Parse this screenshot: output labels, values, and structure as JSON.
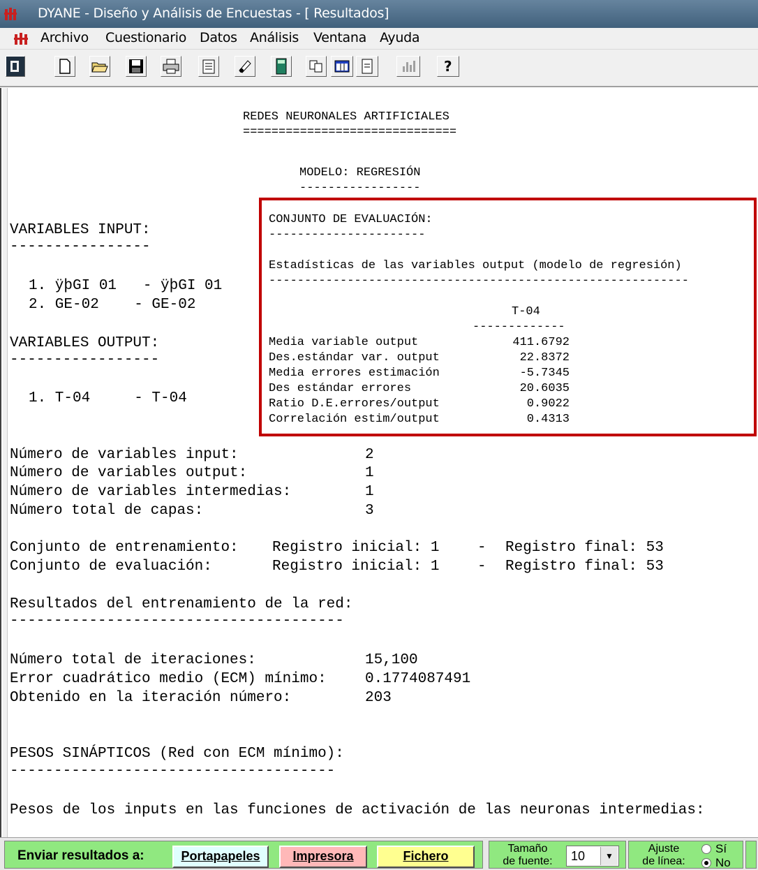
{
  "window": {
    "title": "DYANE - Diseño y Análisis de Encuestas - [ Resultados]"
  },
  "menu": [
    "Archivo",
    "Cuestionario",
    "Datos",
    "Análisis",
    "Ventana",
    "Ayuda"
  ],
  "toolbar_icons": [
    "app-icon",
    "new-file-icon",
    "open-folder-icon",
    "save-icon",
    "print-icon",
    "notepad-icon",
    "edit-icon",
    "calculator-icon",
    "copy-icon",
    "table-icon",
    "document-icon",
    "chart-icon",
    "help-icon"
  ],
  "report": {
    "title": "REDES NEURONALES ARTIFICIALES",
    "title_rule": "==============================",
    "model": "MODELO: REGRESIÓN",
    "model_rule": "-----------------",
    "inputs_header": "VARIABLES INPUT:",
    "inputs_rule": "----------------",
    "inputs": [
      "1. ÿþGI 01   - ÿþGI 01",
      "2. GE-02    - GE-02"
    ],
    "outputs_header": "VARIABLES OUTPUT:",
    "outputs_rule": "-----------------",
    "outputs": [
      "1. T-04     - T-04"
    ],
    "eval_header": "CONJUNTO DE EVALUACIÓN:",
    "eval_rule": "----------------------",
    "stats_header": "Estadísticas de las variables output (modelo de regresión)",
    "stats_rule": "-----------------------------------------------------------",
    "stats_column": "T-04",
    "stats_column_rule": "-------------",
    "stats": [
      {
        "label": "Media variable output",
        "value": "411.6792"
      },
      {
        "label": "Des.estándar var. output",
        "value": "22.8372"
      },
      {
        "label": "Media errores estimación",
        "value": "-5.7345"
      },
      {
        "label": "Des estándar errores",
        "value": "20.6035"
      },
      {
        "label": "Ratio D.E.errores/output",
        "value": "0.9022"
      },
      {
        "label": "Correlación estim/output",
        "value": "0.4313"
      }
    ],
    "counts": [
      {
        "label": "Número de variables input:",
        "value": "2"
      },
      {
        "label": "Número de variables output:",
        "value": "1"
      },
      {
        "label": "Número de variables intermedias:",
        "value": "1"
      },
      {
        "label": "Número total de capas:",
        "value": "3"
      }
    ],
    "sets": [
      {
        "label": "Conjunto de entrenamiento:",
        "initial": "Registro inicial: 1",
        "final": "Registro final: 53"
      },
      {
        "label": "Conjunto de evaluación:",
        "initial": "Registro inicial: 1",
        "final": "Registro final: 53"
      }
    ],
    "training_header": "Resultados del entrenamiento de la red:",
    "training_rule": "--------------------------------------",
    "training": [
      {
        "label": "Número total de iteraciones:",
        "value": "15,100"
      },
      {
        "label": "Error cuadrático medio (ECM) mínimo:",
        "value": "0.1774087491"
      },
      {
        "label": "Obtenido en la iteración número:",
        "value": "203"
      }
    ],
    "weights_header": "PESOS SINÁPTICOS (Red con ECM mínimo):",
    "weights_rule": "-------------------------------------",
    "weights_line": "Pesos de los inputs en las funciones de activación de las neuronas intermedias:"
  },
  "bottom": {
    "send_label": "Enviar resultados a:",
    "buttons": [
      "Portapapeles",
      "Impresora",
      "Fichero"
    ],
    "font_size_label_1": "Tamaño",
    "font_size_label_2": "de fuente:",
    "font_size_value": "10",
    "line_adj_label_1": "Ajuste",
    "line_adj_label_2": "de línea:",
    "opt_yes": "Sí",
    "opt_no": "No"
  }
}
